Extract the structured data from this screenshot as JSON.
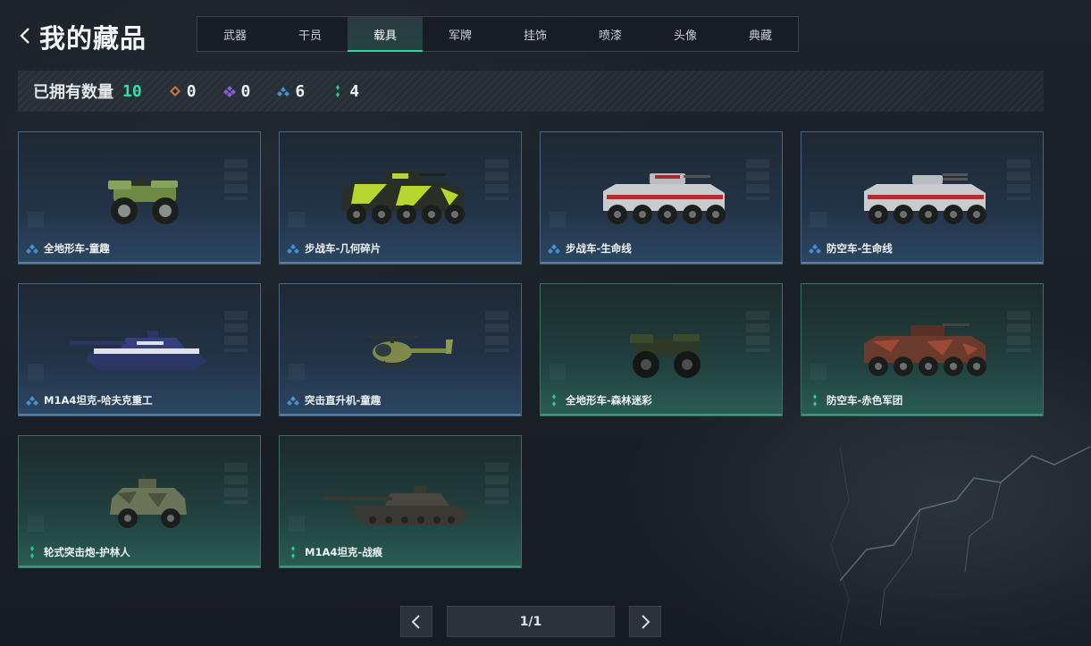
{
  "header": {
    "title": "我的藏品"
  },
  "tabs": [
    {
      "label": "武器"
    },
    {
      "label": "干员"
    },
    {
      "label": "载具",
      "active": true
    },
    {
      "label": "军牌"
    },
    {
      "label": "挂饰"
    },
    {
      "label": "喷漆"
    },
    {
      "label": "头像"
    },
    {
      "label": "典藏"
    }
  ],
  "summary": {
    "label": "已拥有数量",
    "total": "10",
    "rarities": [
      {
        "icon": "orange-diamond-icon",
        "color": "#c8743a",
        "count": "0"
      },
      {
        "icon": "purple-diamond-icon",
        "color": "#8a5fd6",
        "count": "0"
      },
      {
        "icon": "blue-rank-icon",
        "color": "#4a90d0",
        "count": "6"
      },
      {
        "icon": "green-dots-icon",
        "color": "#2fc990",
        "count": "4"
      }
    ]
  },
  "colors": {
    "accent": "#2fd6a2",
    "blue_rarity": "#4a90d0",
    "green_rarity": "#2fc990"
  },
  "items": [
    {
      "name": "全地形车-童趣",
      "rarity": "blue",
      "vehicle": "atv",
      "paint": "green"
    },
    {
      "name": "步战车-几何碎片",
      "rarity": "blue",
      "vehicle": "apc",
      "paint": "yellow"
    },
    {
      "name": "步战车-生命线",
      "rarity": "blue",
      "vehicle": "apc",
      "paint": "white"
    },
    {
      "name": "防空车-生命线",
      "rarity": "blue",
      "vehicle": "apc",
      "paint": "white"
    },
    {
      "name": "M1A4坦克-哈夫克重工",
      "rarity": "blue",
      "vehicle": "tank",
      "paint": "navy"
    },
    {
      "name": "突击直升机-童趣",
      "rarity": "blue",
      "vehicle": "heli",
      "paint": "olive"
    },
    {
      "name": "全地形车-森林迷彩",
      "rarity": "green",
      "vehicle": "atv",
      "paint": "camo"
    },
    {
      "name": "防空车-赤色军团",
      "rarity": "green",
      "vehicle": "apc",
      "paint": "red"
    },
    {
      "name": "轮式突击炮-护林人",
      "rarity": "green",
      "vehicle": "armoredcar",
      "paint": "camo"
    },
    {
      "name": "M1A4坦克-战痕",
      "rarity": "green",
      "vehicle": "tank",
      "paint": "dark"
    }
  ],
  "pagination": {
    "page_text": "1/1"
  }
}
